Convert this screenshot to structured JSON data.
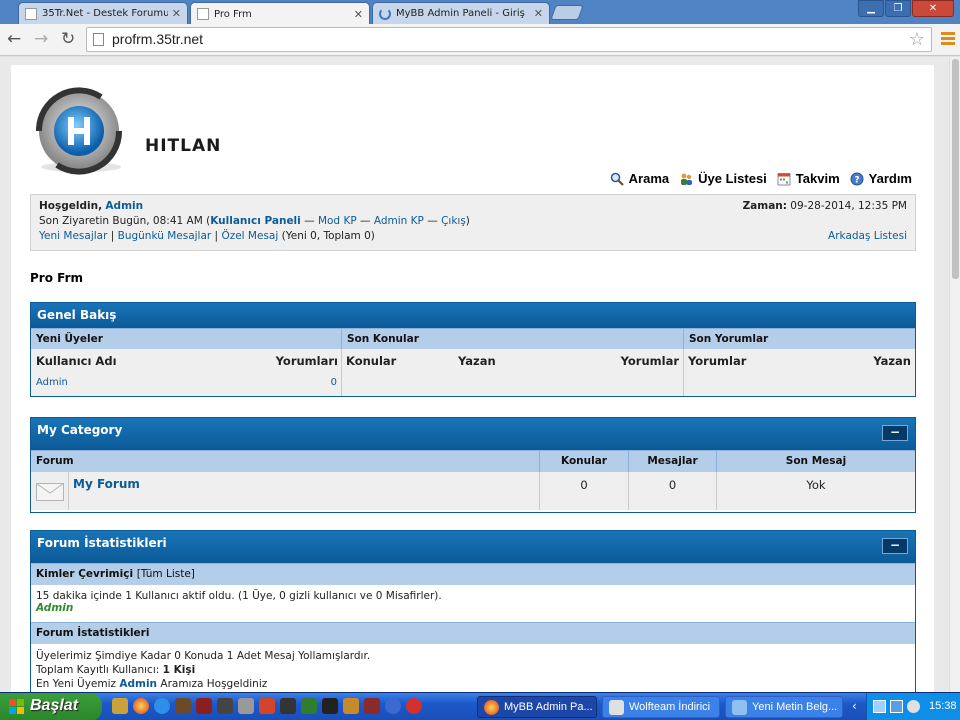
{
  "browser": {
    "tabs": [
      {
        "title": "35Tr.Net - Destek Forumu",
        "active": false
      },
      {
        "title": "Pro Frm",
        "active": true
      },
      {
        "title": "MyBB Admin Paneli - Giriş",
        "active": false
      }
    ],
    "url": "profrm.35tr.net"
  },
  "logo": {
    "text": "HITLAN"
  },
  "toplinks": [
    {
      "label": "Arama",
      "icon": "search-icon"
    },
    {
      "label": "Üye Listesi",
      "icon": "members-icon"
    },
    {
      "label": "Takvim",
      "icon": "calendar-icon"
    },
    {
      "label": "Yardım",
      "icon": "help-icon"
    }
  ],
  "welcome": {
    "greeting": "Hoşgeldin,",
    "username": "Admin",
    "last_visit_prefix": "Son Ziyaretin Bugün, 08:41 AM (",
    "user_panel": "Kullanıcı Paneli",
    "sep": " — ",
    "mod_cp": "Mod KP",
    "admin_cp": "Admin KP",
    "logout": "Çıkış",
    "close_paren": ")",
    "new_posts": "Yeni Mesajlar",
    "todays_posts": "Bugünkü Mesajlar",
    "pipe": " | ",
    "pm": "Özel Mesaj",
    "pm_counts": " (Yeni 0, Toplam 0)",
    "time_label": "Zaman:",
    "time_value": " 09-28-2014, 12:35 PM",
    "buddy_list": "Arkadaş Listesi"
  },
  "board_title": "Pro Frm",
  "overview": {
    "title": "Genel Bakış",
    "sections": [
      "Yeni Üyeler",
      "Son Konular",
      "Son Yorumlar"
    ],
    "new_members_cols": [
      "Kullanıcı Adı",
      "Yorumları"
    ],
    "latest_threads_cols": [
      "Konular",
      "Yazan",
      "Yorumlar"
    ],
    "latest_posts_cols": [
      "Yorumlar",
      "Yazan"
    ],
    "member_rows": [
      {
        "name": "Admin",
        "posts": "0"
      }
    ]
  },
  "category": {
    "title": "My Category",
    "collapse": "−",
    "cols": [
      "Forum",
      "Konular",
      "Mesajlar",
      "Son Mesaj"
    ],
    "forums": [
      {
        "name": "My Forum",
        "threads": "0",
        "posts": "0",
        "last": "Yok"
      }
    ]
  },
  "stats": {
    "title": "Forum İstatistikleri",
    "collapse": "−",
    "online_title": "Kimler Çevrimiçi",
    "online_link": "[Tüm Liste]",
    "online_text": "15 dakika içinde 1 Kullanıcı aktif oldu. (1 Üye, 0 gizli kullanıcı ve 0 Misafirler).",
    "online_user": "Admin",
    "stats_title": "Forum İstatistikleri",
    "stats_line1": "Üyelerimiz Şimdiye Kadar 0 Konuda 1 Adet Mesaj Yollamışlardır.",
    "stats_line2_prefix": "Toplam Kayıtlı Kullanıcı: ",
    "stats_line2_value": "1 Kişi",
    "stats_line3_prefix": "En Yeni Üyemiz ",
    "stats_line3_user": "Admin",
    "stats_line3_suffix": " Aramıza Hoşgeldiniz"
  },
  "taskbar": {
    "start": "Başlat",
    "tasks": [
      "MyBB Admin Pa...",
      "Wolfteam İndirici",
      "Yeni Metin Belg..."
    ],
    "clock": "15:38"
  }
}
